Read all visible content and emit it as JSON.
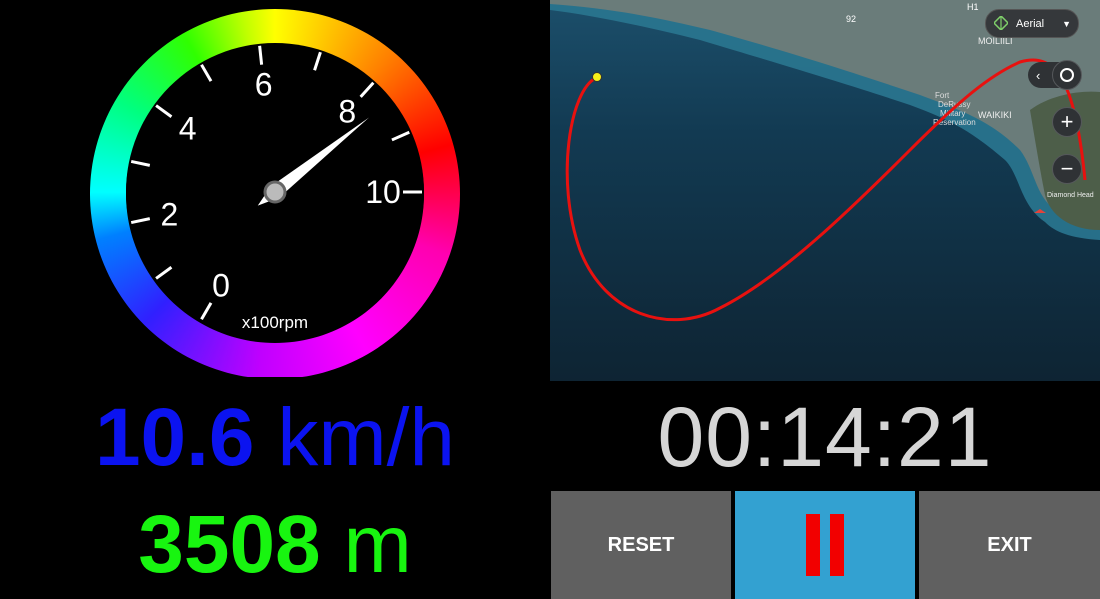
{
  "gauge": {
    "tick_labels": [
      "0",
      "2",
      "4",
      "6",
      "8",
      "10"
    ],
    "unit": "x100rpm",
    "needle_value": 8.4,
    "min": 0,
    "max": 10
  },
  "speed": {
    "value": "10.6",
    "unit": "km/h",
    "color": "#0b13f0"
  },
  "distance": {
    "value": "3508",
    "unit": "m",
    "color": "#18f510"
  },
  "timer": {
    "text": "00:14:21"
  },
  "map": {
    "type_label": "Aerial",
    "labels": [
      "92",
      "H1",
      "MOILIILI",
      "Fort",
      "DeRussy",
      "Military",
      "Reservation",
      "WAIKIKI",
      "Diamond Head"
    ],
    "route_color": "#e8110f",
    "start_marker_color": "#f6f01a"
  },
  "buttons": {
    "reset": "RESET",
    "exit": "EXIT"
  },
  "colors": {
    "button_gray": "#606060",
    "button_blue": "#33a1d1",
    "pause_red": "#f20000",
    "timer_text": "#d6d6d6"
  }
}
